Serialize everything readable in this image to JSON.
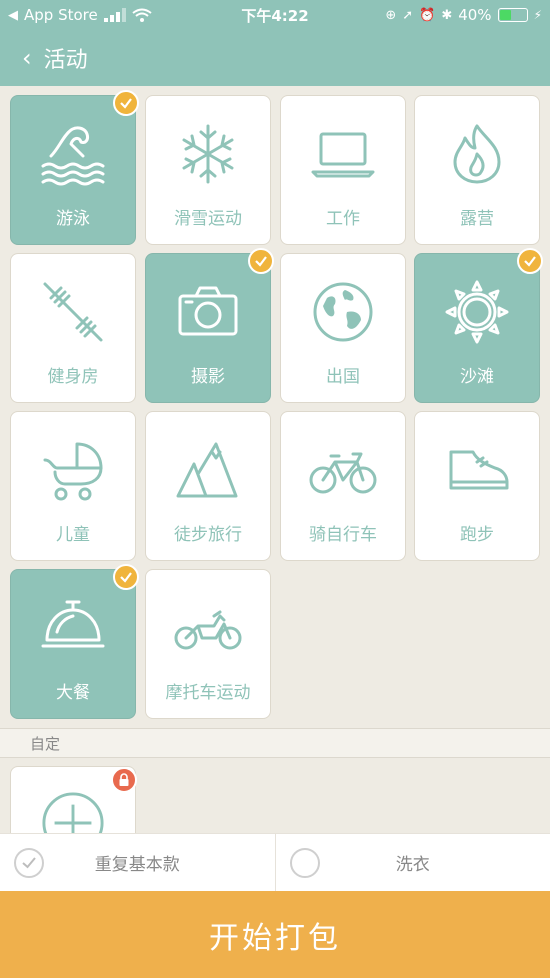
{
  "status": {
    "carrier": "App Store",
    "time": "下午4:22",
    "battery": "40%",
    "battery_level": 0.4
  },
  "nav": {
    "title": "活动"
  },
  "activities": [
    {
      "label": "游泳",
      "icon": "swimming-icon",
      "selected": true
    },
    {
      "label": "滑雪运动",
      "icon": "snowflake-icon",
      "selected": false
    },
    {
      "label": "工作",
      "icon": "laptop-icon",
      "selected": false
    },
    {
      "label": "露营",
      "icon": "campfire-icon",
      "selected": false
    },
    {
      "label": "健身房",
      "icon": "barbell-icon",
      "selected": false
    },
    {
      "label": "摄影",
      "icon": "camera-icon",
      "selected": true
    },
    {
      "label": "出国",
      "icon": "globe-icon",
      "selected": false
    },
    {
      "label": "沙滩",
      "icon": "sun-icon",
      "selected": true
    },
    {
      "label": "儿童",
      "icon": "stroller-icon",
      "selected": false
    },
    {
      "label": "徒步旅行",
      "icon": "mountain-icon",
      "selected": false
    },
    {
      "label": "骑自行车",
      "icon": "bicycle-icon",
      "selected": false
    },
    {
      "label": "跑步",
      "icon": "shoe-icon",
      "selected": false
    },
    {
      "label": "大餐",
      "icon": "cloche-icon",
      "selected": true
    },
    {
      "label": "摩托车运动",
      "icon": "motorcycle-icon",
      "selected": false
    }
  ],
  "custom": {
    "section_label": "自定",
    "add_icon": "plus-circle-icon",
    "locked": true
  },
  "options": [
    {
      "label": "重复基本款",
      "checked": true
    },
    {
      "label": "洗衣",
      "checked": false
    }
  ],
  "start_button": {
    "label": "开始打包"
  },
  "colors": {
    "accent": "#8fc3b8",
    "check": "#f0b43c",
    "lock": "#e86a4e",
    "start": "#efb04c"
  }
}
